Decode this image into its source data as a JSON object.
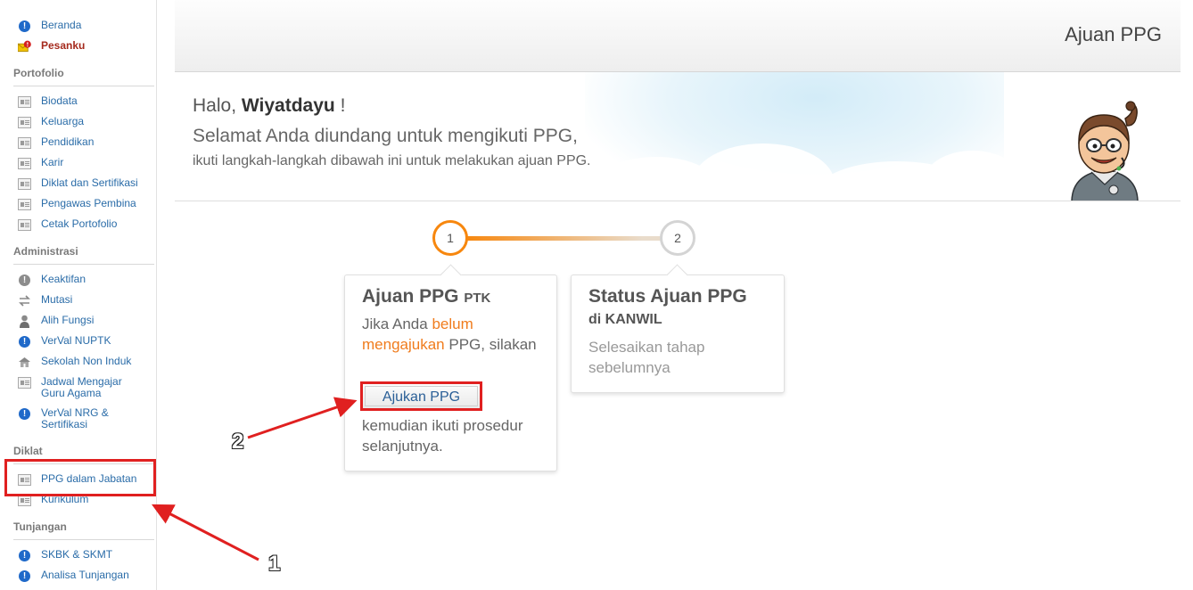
{
  "sidebar": {
    "top_items": [
      {
        "label": "Beranda",
        "icon": "info-icon"
      },
      {
        "label": "Pesanku",
        "icon": "mail-alert-icon"
      }
    ],
    "portofolio": {
      "title": "Portofolio",
      "items": [
        "Biodata",
        "Keluarga",
        "Pendidikan",
        "Karir",
        "Diklat dan Sertifikasi",
        "Pengawas Pembina",
        "Cetak Portofolio"
      ]
    },
    "administrasi": {
      "title": "Administrasi",
      "items": [
        {
          "label": "Keaktifan",
          "icon": "info-grey-icon"
        },
        {
          "label": "Mutasi",
          "icon": "transfer-icon"
        },
        {
          "label": "Alih Fungsi",
          "icon": "person-icon"
        },
        {
          "label": "VerVal NUPTK",
          "icon": "info-icon"
        },
        {
          "label": "Sekolah Non Induk",
          "icon": "school-icon"
        },
        {
          "label": "Jadwal Mengajar Guru Agama",
          "icon": "document-icon"
        },
        {
          "label": "VerVal NRG & Sertifikasi",
          "icon": "info-icon"
        }
      ]
    },
    "diklat": {
      "title": "Diklat",
      "items": [
        "PPG dalam Jabatan",
        "Kurikulum"
      ]
    },
    "tunjangan": {
      "title": "Tunjangan",
      "items": [
        "SKBK & SKMT",
        "Analisa Tunjangan"
      ]
    }
  },
  "header": {
    "title": "Ajuan PPG"
  },
  "hero": {
    "greeting_prefix": "Halo,",
    "user_name": "Wiyatdayu",
    "greeting_suffix": "!",
    "invite": "Selamat Anda diundang untuk mengikuti PPG,",
    "instructions": "ikuti langkah-langkah dibawah ini untuk melakukan ajuan PPG."
  },
  "steps": {
    "one": "1",
    "two": "2"
  },
  "card1": {
    "title": "Ajuan PPG",
    "title_suffix": "PTK",
    "text_a": "Jika Anda",
    "highlight": "belum mengajukan",
    "text_b": "PPG, silakan",
    "button": "Ajukan PPG",
    "text_after": "kemudian ikuti prosedur selanjutnya."
  },
  "card2": {
    "title": "Status Ajuan PPG",
    "subtitle": "di KANWIL",
    "text": "Selesaikan tahap sebelumnya"
  },
  "annotations": {
    "one": "1",
    "two": "2"
  },
  "colors": {
    "accent": "#f7870e",
    "link": "#2a6ca8",
    "highlight_box": "#e02020"
  }
}
